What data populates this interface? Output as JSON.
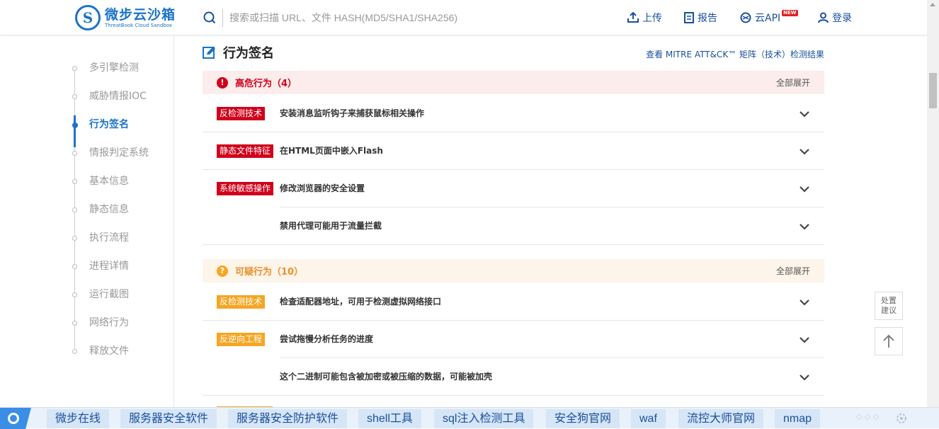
{
  "header": {
    "logo_title": "微步云沙箱",
    "logo_subtitle": "ThreatBook Cloud Sandbox",
    "search_placeholder": "搜索或扫描 URL、文件 HASH(MD5/SHA1/SHA256)",
    "nav": {
      "upload": "上传",
      "report": "报告",
      "api": "云API",
      "api_badge": "NEW",
      "login": "登录"
    }
  },
  "sidebar": {
    "items": [
      {
        "label": "多引擎检测"
      },
      {
        "label": "威胁情报IOC"
      },
      {
        "label": "行为签名"
      },
      {
        "label": "情报判定系统"
      },
      {
        "label": "基本信息"
      },
      {
        "label": "静态信息"
      },
      {
        "label": "执行流程"
      },
      {
        "label": "进程详情"
      },
      {
        "label": "运行截图"
      },
      {
        "label": "网络行为"
      },
      {
        "label": "释放文件"
      }
    ],
    "active_index": 2
  },
  "main": {
    "section_title": "行为签名",
    "mitre_link": "查看 MITRE ATT&CK™ 矩阵（技术）检测结果",
    "groups": [
      {
        "label": "高危行为（4）",
        "icon": "!",
        "expand_all": "全部展开",
        "color": "#d0021b",
        "rows": [
          {
            "tag": "反检测技术",
            "text": "安装消息监听钩子来捕获鼠标相关操作"
          },
          {
            "tag": "静态文件特征",
            "text": "在HTML页面中嵌入Flash"
          },
          {
            "tag": "系统敏感操作",
            "text": "修改浏览器的安全设置"
          },
          {
            "tag": "",
            "text": "禁用代理可能用于流量拦截"
          }
        ]
      },
      {
        "label": "可疑行为（10）",
        "icon": "?",
        "expand_all": "全部展开",
        "color": "#f5a623",
        "rows": [
          {
            "tag": "反检测技术",
            "text": "检查适配器地址，可用于检测虚拟网络接口"
          },
          {
            "tag": "反逆向工程",
            "text": "尝试拖慢分析任务的进度"
          },
          {
            "tag": "",
            "text": "这个二进制可能包含被加密或被压缩的数据，可能被加壳"
          }
        ]
      }
    ]
  },
  "floating": {
    "advice_line1": "处置",
    "advice_line2": "建议"
  },
  "bottombar": {
    "ads": [
      "微步在线",
      "服务器安全软件",
      "服务器安全防护软件",
      "shell工具",
      "sql注入检测工具",
      "安全狗官网",
      "waf",
      "流控大师官网",
      "nmap"
    ],
    "faint_text": "◇ ◇ ◇"
  }
}
